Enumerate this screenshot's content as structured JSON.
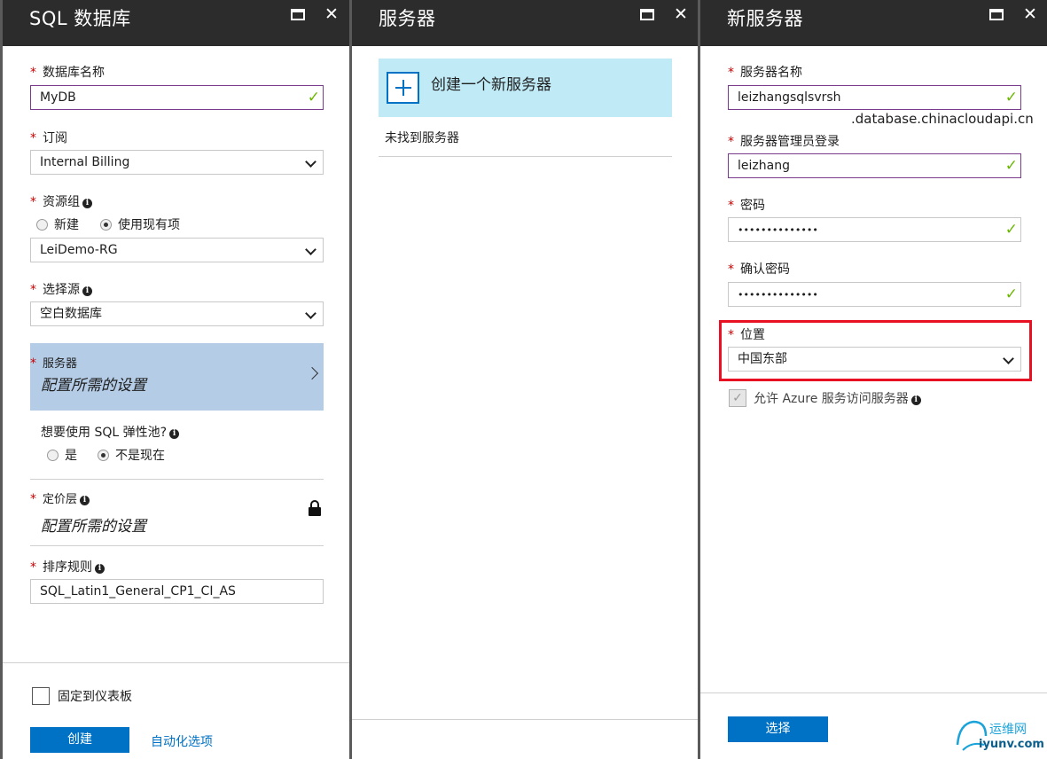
{
  "blade1": {
    "title": "SQL 数据库",
    "db_name_label": "数据库名称",
    "db_name_value": "MyDB",
    "subscription_label": "订阅",
    "subscription_value": "Internal Billing",
    "resource_group_label": "资源组",
    "rg_option_new": "新建",
    "rg_option_existing": "使用现有项",
    "resource_group_value": "LeiDemo-RG",
    "source_label": "选择源",
    "source_value": "空白数据库",
    "server_label": "服务器",
    "server_value": "配置所需的设置",
    "elastic_pool_question": "想要使用 SQL 弹性池?",
    "elastic_yes": "是",
    "elastic_not_now": "不是现在",
    "pricing_label": "定价层",
    "pricing_value": "配置所需的设置",
    "collation_label": "排序规则",
    "collation_value": "SQL_Latin1_General_CP1_CI_AS",
    "pin_dashboard": "固定到仪表板",
    "create_button": "创建",
    "automation_link": "自动化选项"
  },
  "blade2": {
    "title": "服务器",
    "create_new_server": "创建一个新服务器",
    "no_servers_found": "未找到服务器"
  },
  "blade3": {
    "title": "新服务器",
    "server_name_label": "服务器名称",
    "server_name_value": "leizhangsqlsvrsh",
    "server_name_suffix": ".database.chinacloudapi.cn",
    "admin_login_label": "服务器管理员登录",
    "admin_login_value": "leizhang",
    "password_label": "密码",
    "password_value": "••••••••••••••",
    "confirm_password_label": "确认密码",
    "confirm_password_value": "••••••••••••••",
    "location_label": "位置",
    "location_value": "中国东部",
    "allow_azure_label": "允许 Azure 服务访问服务器",
    "select_button": "选择"
  },
  "watermark": {
    "text": "运维网",
    "url_text": "iyunv.com"
  },
  "colors": {
    "accent": "#0072c6",
    "highlight_red": "#e81123",
    "selected_blade_item": "#b4cce6",
    "create_item_bg": "#bfeaf6",
    "valid_check": "#6bb700"
  }
}
